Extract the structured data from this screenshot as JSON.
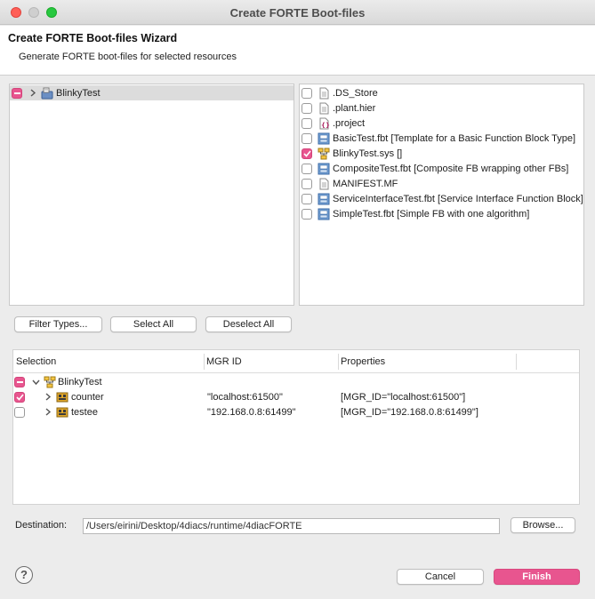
{
  "window": {
    "title": "Create FORTE Boot-files"
  },
  "wizard": {
    "title": "Create FORTE Boot-files Wizard",
    "subtitle": "Generate FORTE boot-files for selected resources"
  },
  "left_tree": {
    "items": [
      {
        "label": "BlinkyTest",
        "state": "mixed",
        "icon": "system-project-icon"
      }
    ]
  },
  "right_list": {
    "items": [
      {
        "label": ".DS_Store",
        "checked": false,
        "icon": "file-icon"
      },
      {
        "label": ".plant.hier",
        "checked": false,
        "icon": "file-icon"
      },
      {
        "label": ".project",
        "checked": false,
        "icon": "project-file-icon"
      },
      {
        "label": "BasicTest.fbt [Template for a Basic Function Block Type]",
        "checked": false,
        "icon": "function-block-icon"
      },
      {
        "label": "BlinkyTest.sys []",
        "checked": true,
        "icon": "system-file-icon"
      },
      {
        "label": "CompositeTest.fbt [Composite FB wrapping other FBs]",
        "checked": false,
        "icon": "function-block-icon"
      },
      {
        "label": "MANIFEST.MF",
        "checked": false,
        "icon": "file-icon"
      },
      {
        "label": "ServiceInterfaceTest.fbt [Service Interface Function Block]",
        "checked": false,
        "icon": "function-block-icon"
      },
      {
        "label": "SimpleTest.fbt [Simple FB with one algorithm]",
        "checked": false,
        "icon": "function-block-icon"
      }
    ]
  },
  "buttons": {
    "filter_types": "Filter Types...",
    "select_all": "Select All",
    "deselect_all": "Deselect All",
    "browse": "Browse...",
    "cancel": "Cancel",
    "finish": "Finish"
  },
  "table": {
    "columns": [
      "Selection",
      "MGR ID",
      "Properties"
    ],
    "root": {
      "label": "BlinkyTest",
      "state": "mixed"
    },
    "rows": [
      {
        "name": "counter",
        "mgr_id": "\"localhost:61500\"",
        "properties": "[MGR_ID=\"localhost:61500\"]",
        "checked": true
      },
      {
        "name": "testee",
        "mgr_id": "\"192.168.0.8:61499\"",
        "properties": "[MGR_ID=\"192.168.0.8:61499\"]",
        "checked": false
      }
    ]
  },
  "destination": {
    "label": "Destination:",
    "value": "/Users/eirini/Desktop/4diacs/runtime/4diacFORTE"
  },
  "help": {
    "glyph": "?"
  },
  "colors": {
    "accent": "#e8558f"
  }
}
